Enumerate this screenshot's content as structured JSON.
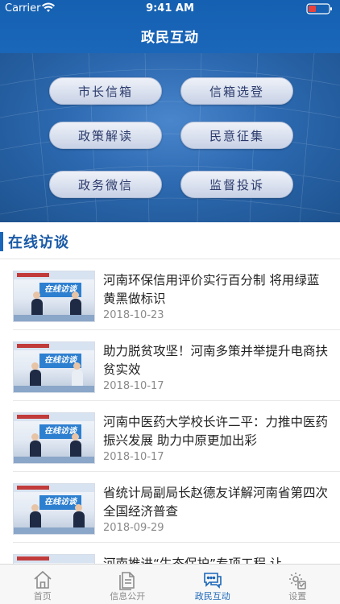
{
  "status": {
    "carrier": "Carrier",
    "time": "9:41 AM"
  },
  "nav": {
    "title": "政民互动"
  },
  "menu": [
    {
      "label": "市长信箱"
    },
    {
      "label": "信箱选登"
    },
    {
      "label": "政策解读"
    },
    {
      "label": "民意征集"
    },
    {
      "label": "政务微信"
    },
    {
      "label": "监督投诉"
    }
  ],
  "section": {
    "title": "在线访谈"
  },
  "thumb_banner": "在线访谈",
  "news": [
    {
      "title": "河南环保信用评价实行百分制 将用绿蓝黄黑做标识",
      "date": "2018-10-23"
    },
    {
      "title": "助力脱贫攻坚！河南多策并举提升电商扶贫实效",
      "date": "2018-10-17"
    },
    {
      "title": "河南中医药大学校长许二平：力推中医药振兴发展 助力中原更加出彩",
      "date": "2018-10-17"
    },
    {
      "title": "省统计局副局长赵德友详解河南省第四次全国经济普查",
      "date": "2018-09-29"
    },
    {
      "title": "河南推进“生态保护”专项工程 让",
      "date": ""
    }
  ],
  "tabs": [
    {
      "label": "首页",
      "icon": "home-icon"
    },
    {
      "label": "信息公开",
      "icon": "document-icon"
    },
    {
      "label": "政民互动",
      "icon": "chat-icon"
    },
    {
      "label": "设置",
      "icon": "settings-icon"
    }
  ],
  "colors": {
    "primary": "#1a66b9",
    "inactive": "#8c8c8c"
  }
}
